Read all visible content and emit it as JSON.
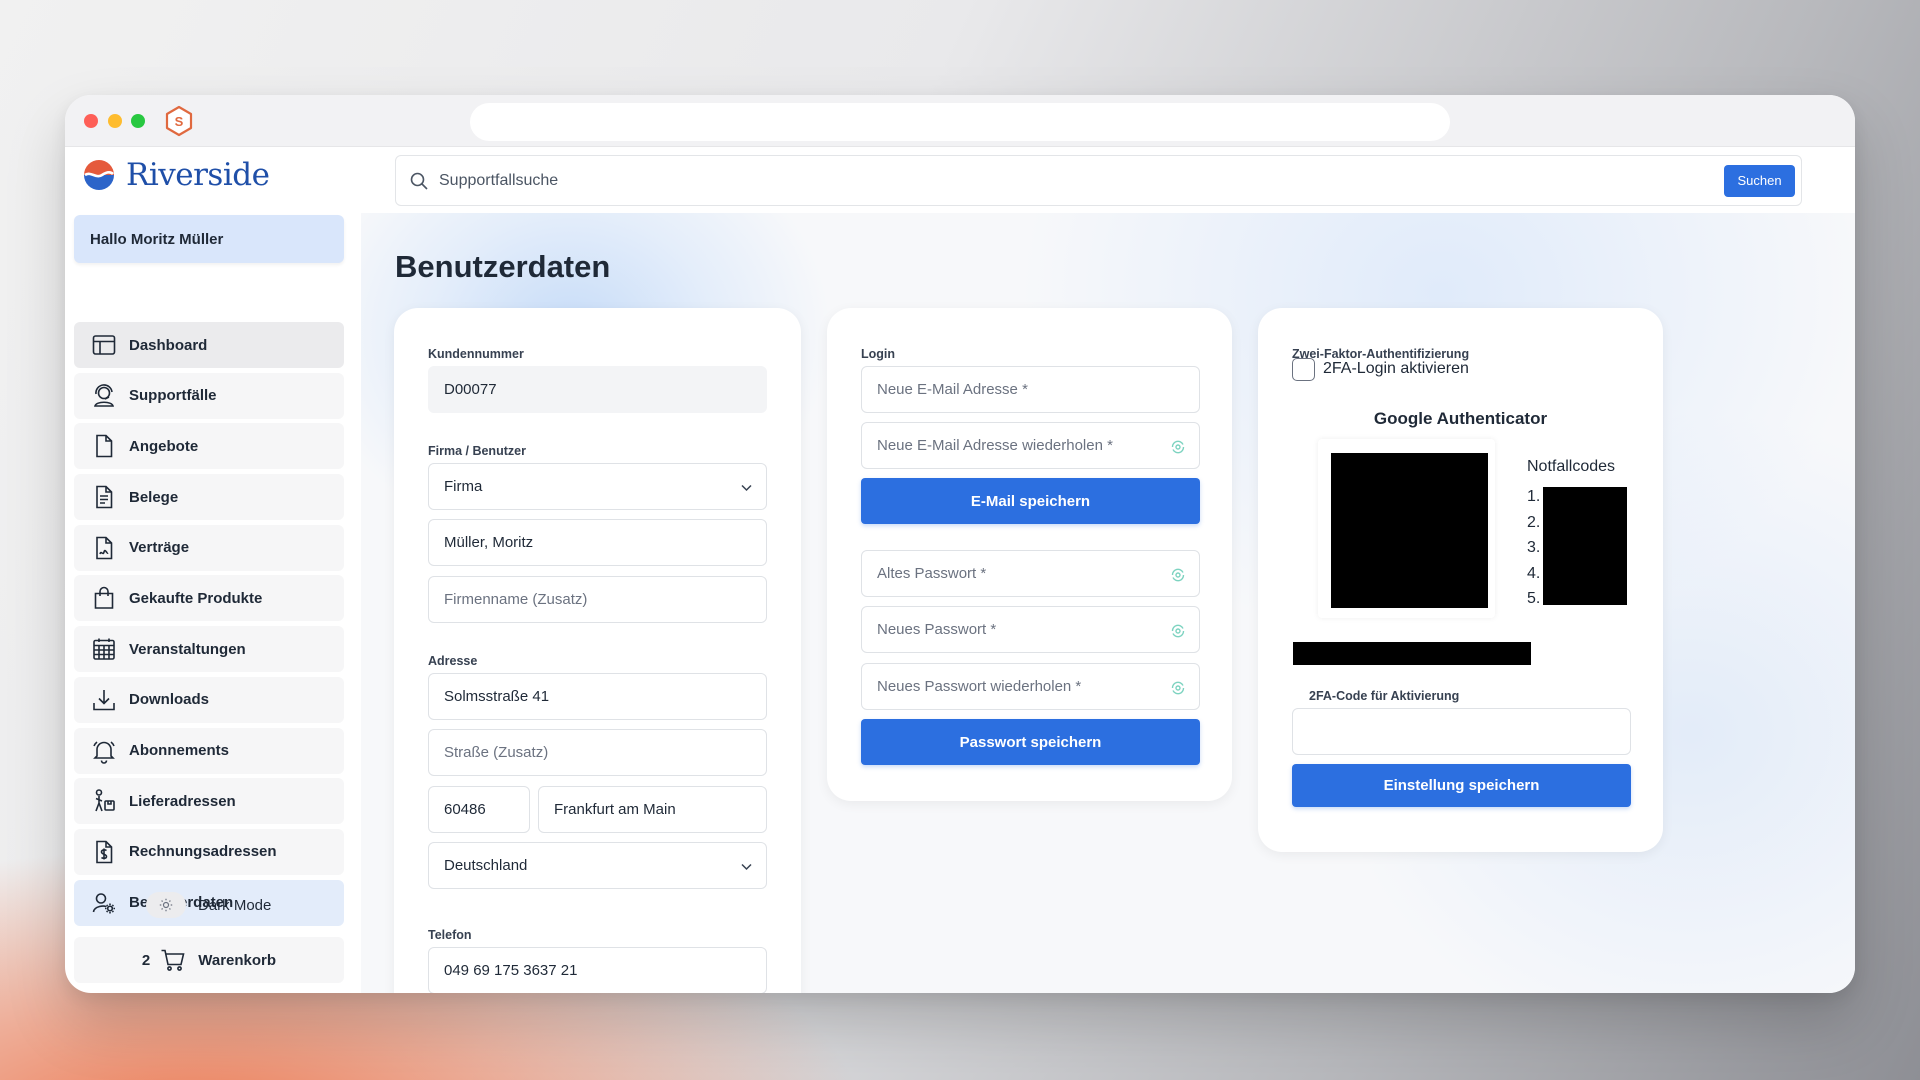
{
  "browser": {
    "app_icon": "s-hexagon-icon"
  },
  "brand": {
    "name": "Riverside"
  },
  "sidebar": {
    "greeting": "Hallo Moritz Müller",
    "items": [
      {
        "label": "Dashboard",
        "icon": "layout-icon"
      },
      {
        "label": "Supportfälle",
        "icon": "support-agent-icon"
      },
      {
        "label": "Angebote",
        "icon": "document-icon"
      },
      {
        "label": "Belege",
        "icon": "receipt-icon"
      },
      {
        "label": "Verträge",
        "icon": "contract-icon"
      },
      {
        "label": "Gekaufte Produkte",
        "icon": "shopping-bag-icon"
      },
      {
        "label": "Veranstaltungen",
        "icon": "calendar-icon"
      },
      {
        "label": "Downloads",
        "icon": "download-icon"
      },
      {
        "label": "Abonnements",
        "icon": "bell-icon"
      },
      {
        "label": "Lieferadressen",
        "icon": "delivery-person-icon"
      },
      {
        "label": "Rechnungsadressen",
        "icon": "invoice-dollar-icon"
      },
      {
        "label": "Benutzerdaten",
        "icon": "user-settings-icon",
        "active": true
      }
    ],
    "dark_mode_label": "Dark Mode",
    "cart": {
      "count": "2",
      "label": "Warenkorb"
    }
  },
  "search": {
    "placeholder": "Supportfallsuche",
    "button": "Suchen"
  },
  "page": {
    "title": "Benutzerdaten"
  },
  "customer": {
    "number_label": "Kundennummer",
    "number_value": "D00077",
    "company_label": "Firma / Benutzer",
    "type_value": "Firma",
    "name_value": "Müller, Moritz",
    "company_extra_placeholder": "Firmenname (Zusatz)",
    "address_label": "Adresse",
    "street_value": "Solmsstraße 41",
    "street_extra_placeholder": "Straße (Zusatz)",
    "zip_value": "60486",
    "city_value": "Frankfurt am Main",
    "country_value": "Deutschland",
    "phone_label": "Telefon",
    "phone_value": "049 69 175 3637 21"
  },
  "login": {
    "label": "Login",
    "new_email_placeholder": "Neue E-Mail Adresse *",
    "repeat_email_placeholder": "Neue E-Mail Adresse wiederholen *",
    "save_email_button": "E-Mail speichern",
    "old_password_placeholder": "Altes Passwort *",
    "new_password_placeholder": "Neues Passwort *",
    "repeat_password_placeholder": "Neues Passwort wiederholen *",
    "save_password_button": "Passwort speichern"
  },
  "twofa": {
    "label": "Zwei-Faktor-Authentifizierung",
    "checkbox_label": "2FA-Login aktivieren",
    "checked": false,
    "authenticator_title": "Google Authenticator",
    "codes_title": "Notfallcodes",
    "code_numbers": [
      "1.",
      "2.",
      "3.",
      "4.",
      "5."
    ],
    "activation_code_label": "2FA-Code für Aktivierung",
    "save_button": "Einstellung speichern"
  },
  "colors": {
    "accent": "#2c6fe0",
    "brand_text": "#1f4fa8",
    "greeting_bg": "#d9e6fb",
    "active_nav_bg": "#e3ecfa"
  }
}
